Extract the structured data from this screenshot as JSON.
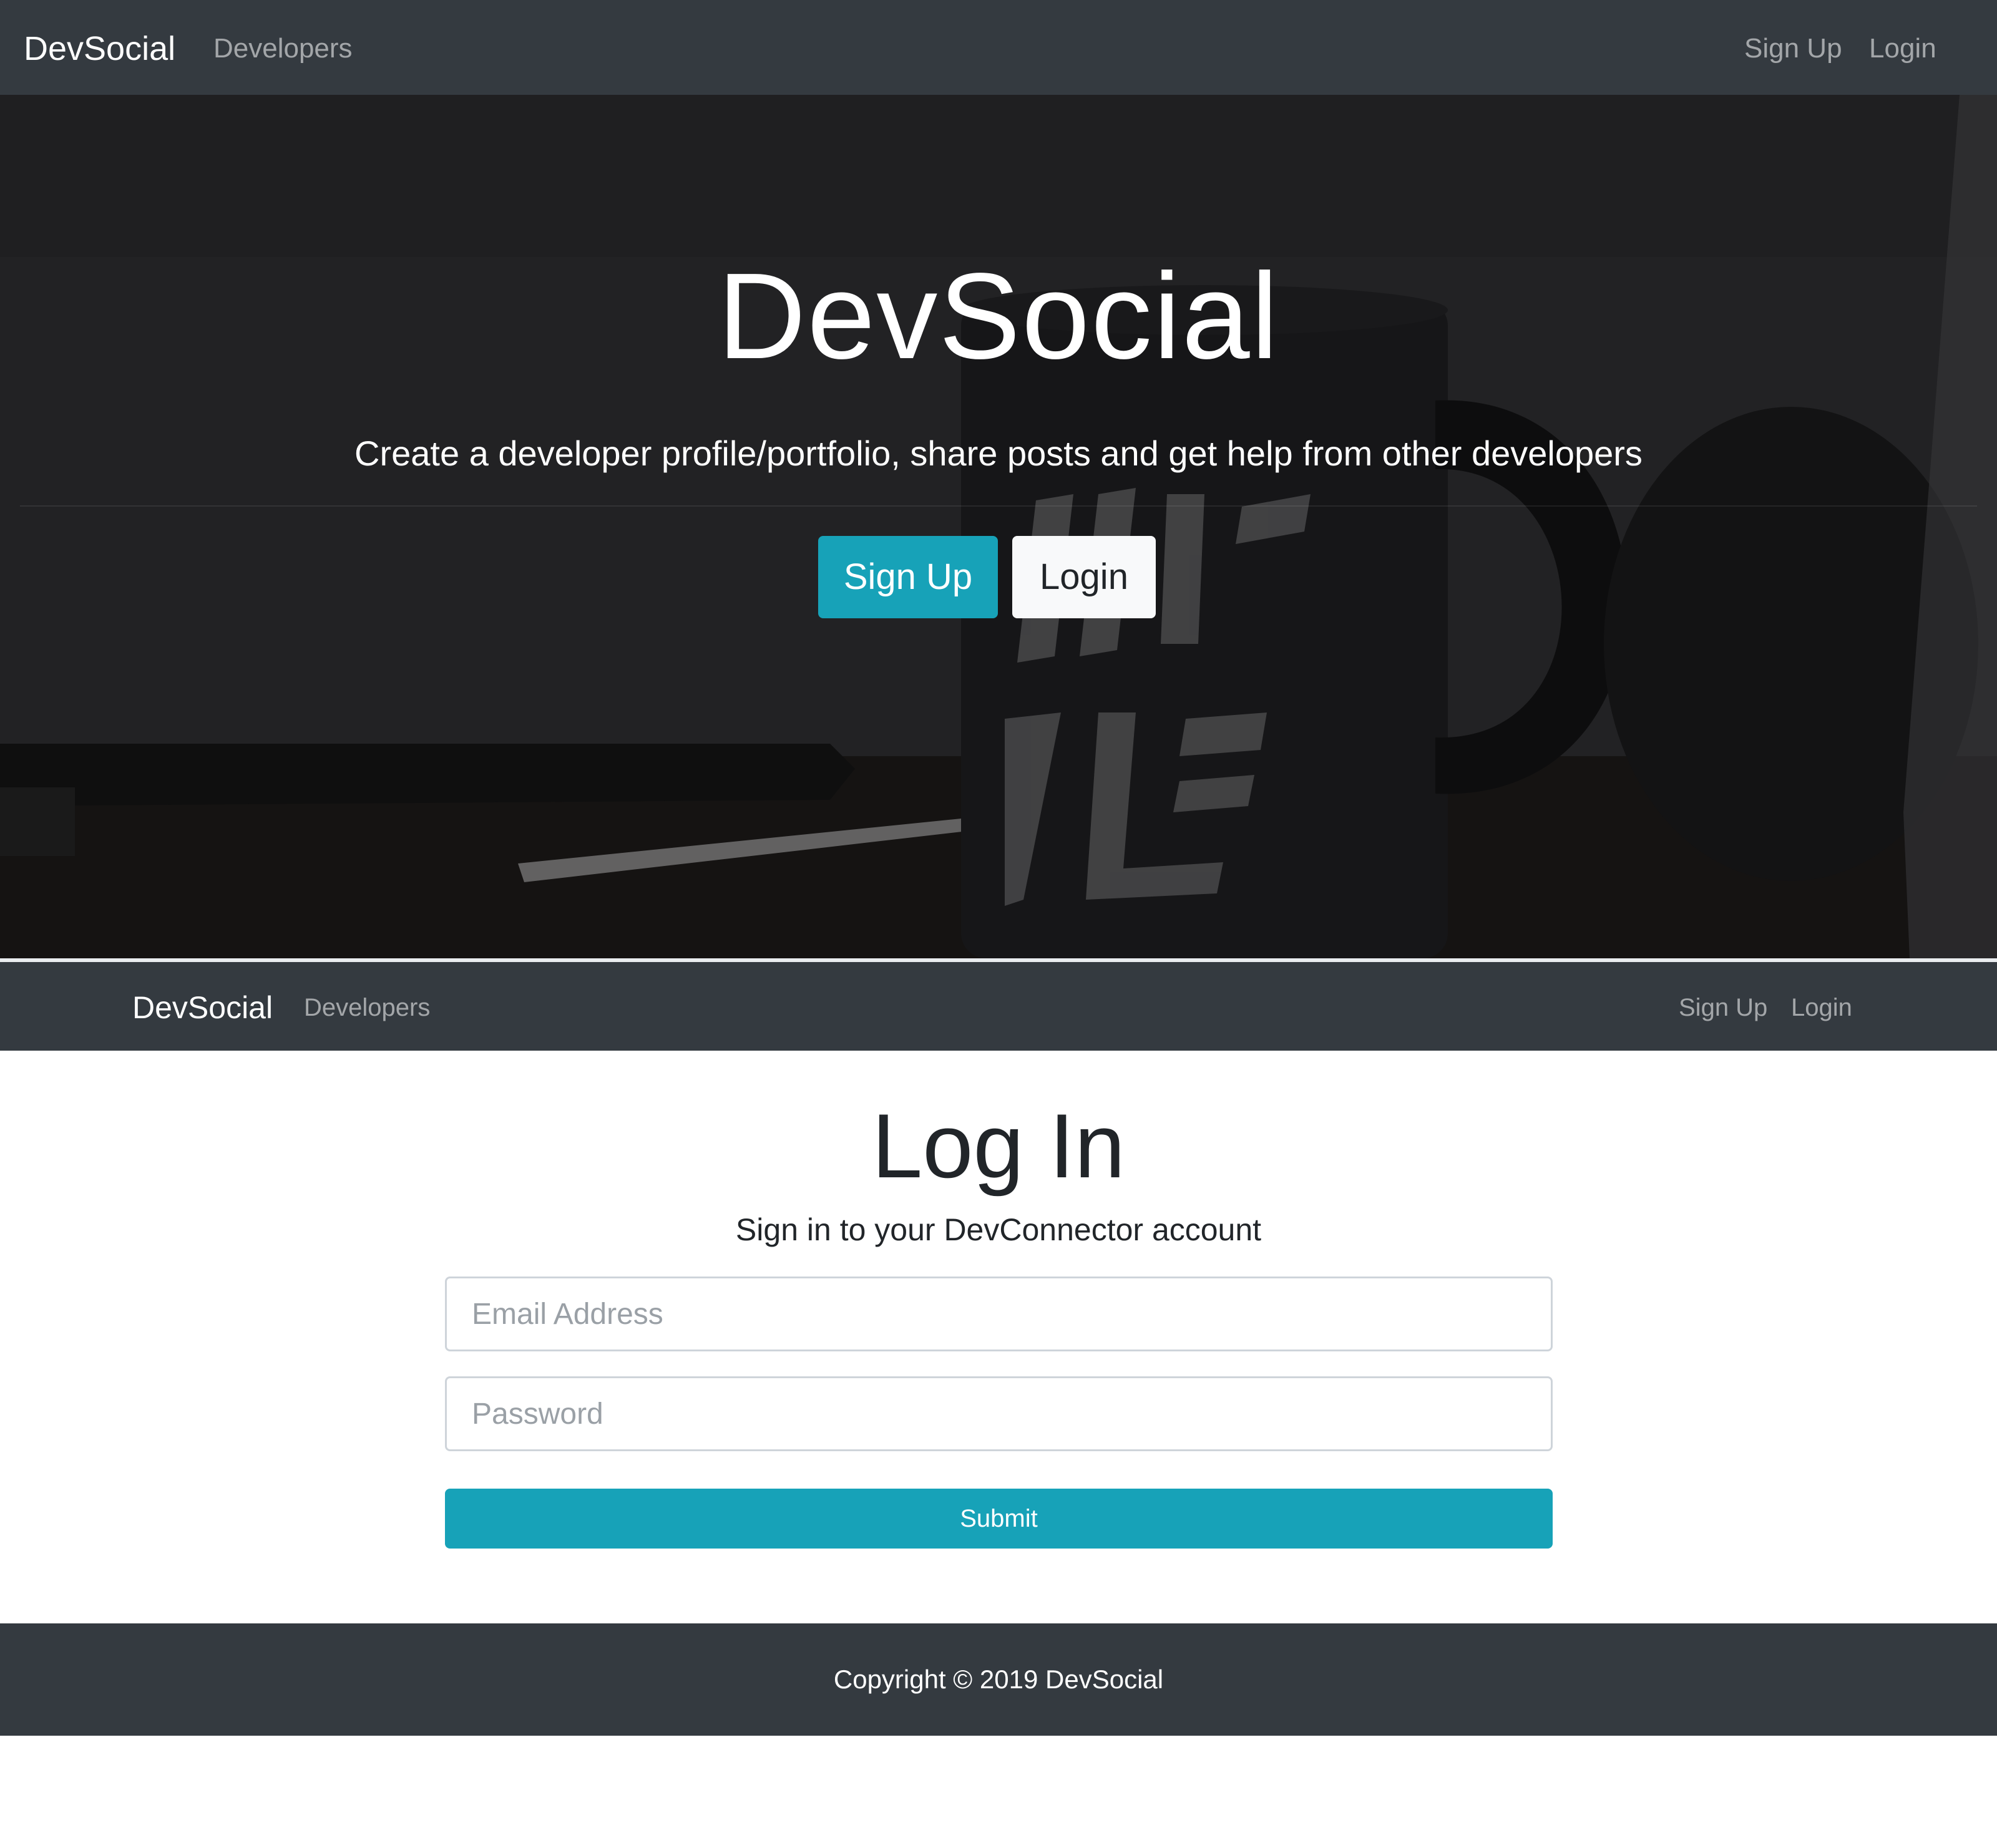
{
  "top_nav": {
    "brand": "DevSocial",
    "developers": "Developers",
    "sign_up": "Sign Up",
    "login": "Login"
  },
  "hero": {
    "title": "DevSocial",
    "lead": "Create a developer profile/portfolio, share posts and get help from other developers",
    "sign_up_button": "Sign Up",
    "login_button": "Login"
  },
  "second_nav": {
    "brand": "DevSocial",
    "developers": "Developers",
    "sign_up": "Sign Up",
    "login": "Login"
  },
  "login": {
    "title": "Log In",
    "subtitle": "Sign in to your DevConnector account",
    "email_placeholder": "Email Address",
    "password_placeholder": "Password",
    "submit_label": "Submit"
  },
  "footer": {
    "copyright": "Copyright © 2019 DevSocial"
  },
  "colors": {
    "navbar": "#343a40",
    "accent": "#17a2b8",
    "light_button": "#f8f9fa"
  }
}
